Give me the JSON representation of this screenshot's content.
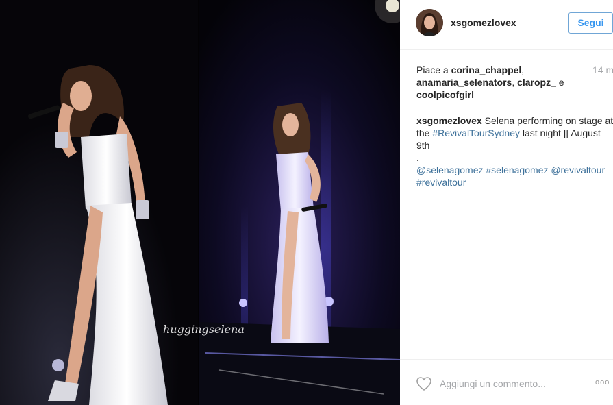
{
  "post": {
    "username": "xsgomezlovex",
    "follow_label": "Segui",
    "likes": {
      "prefix": "Piace a ",
      "users": [
        "corina_chappel",
        "anamaria_selenators",
        "claropz_",
        "coolpicofgirl"
      ],
      "sep1": ", ",
      "sep2": ", ",
      "conj": " e "
    },
    "timestamp": "14 m",
    "caption": {
      "user": "xsgomezlovex",
      "text1": " Selena performing on stage at the ",
      "tag1": "#RevivalTourSydney",
      "text2": " last night || August 9th",
      "dot": ".",
      "mention1": "@selenagomez",
      "tag2": "#selenagomez",
      "mention2": "@revivaltour",
      "tag3": "#revivaltour"
    },
    "photo_watermark": "huggingselena",
    "comment_placeholder": "Aggiungi un commento...",
    "more_label": "ooo"
  },
  "icons": {
    "heart": "heart-outline-icon",
    "more": "more-options-icon"
  },
  "colors": {
    "link": "#3f729b",
    "follow": "#3897f0",
    "muted": "#a5a7aa"
  }
}
